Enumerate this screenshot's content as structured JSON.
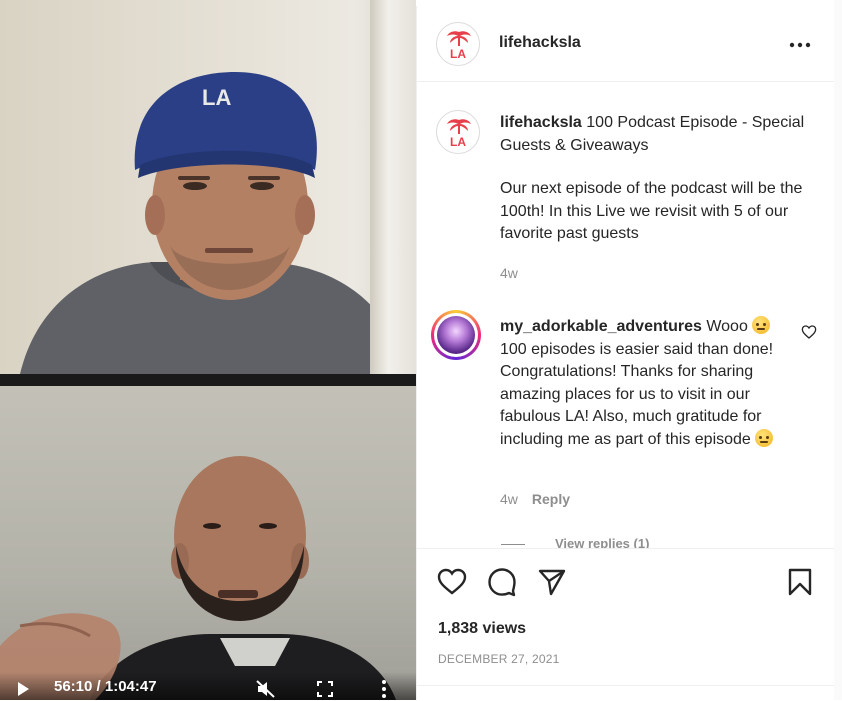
{
  "post": {
    "username": "lifehacksla",
    "caption_title": "100 Podcast Episode - Special Guests & Giveaways",
    "caption_body": "Our next episode of the podcast will be the 100th! In this Live we revisit with 5 of our favorite past guests",
    "caption_age": "4w",
    "avatar_letters": "LA",
    "views": "1,838 views",
    "date": "DECEMBER 27, 2021"
  },
  "comment": {
    "username": "my_adorkable_adventures",
    "text_before_emoji": "Wooo",
    "text_after_emoji": "100 episodes is easier said than done! Congratulations! Thanks for sharing amazing places for us to visit in our fabulous LA! Also, much gratitude for including me as part of this episode",
    "age": "4w",
    "reply_label": "Reply",
    "view_replies": "View replies (1)"
  },
  "video": {
    "timecode": "56:10 / 1:04:47"
  },
  "icons": {
    "header_more": "more-horizontal-icon",
    "like": "heart-icon",
    "comment": "comment-bubble-icon",
    "share": "paper-plane-icon",
    "save": "bookmark-icon",
    "play": "play-icon",
    "mute": "muted-speaker-icon",
    "fullscreen": "fullscreen-icon",
    "more_vertical": "more-vertical-icon"
  },
  "colors": {
    "brand_red": "#e8404a",
    "text": "#262626",
    "muted": "#8e8e8e",
    "border": "#efefef"
  }
}
